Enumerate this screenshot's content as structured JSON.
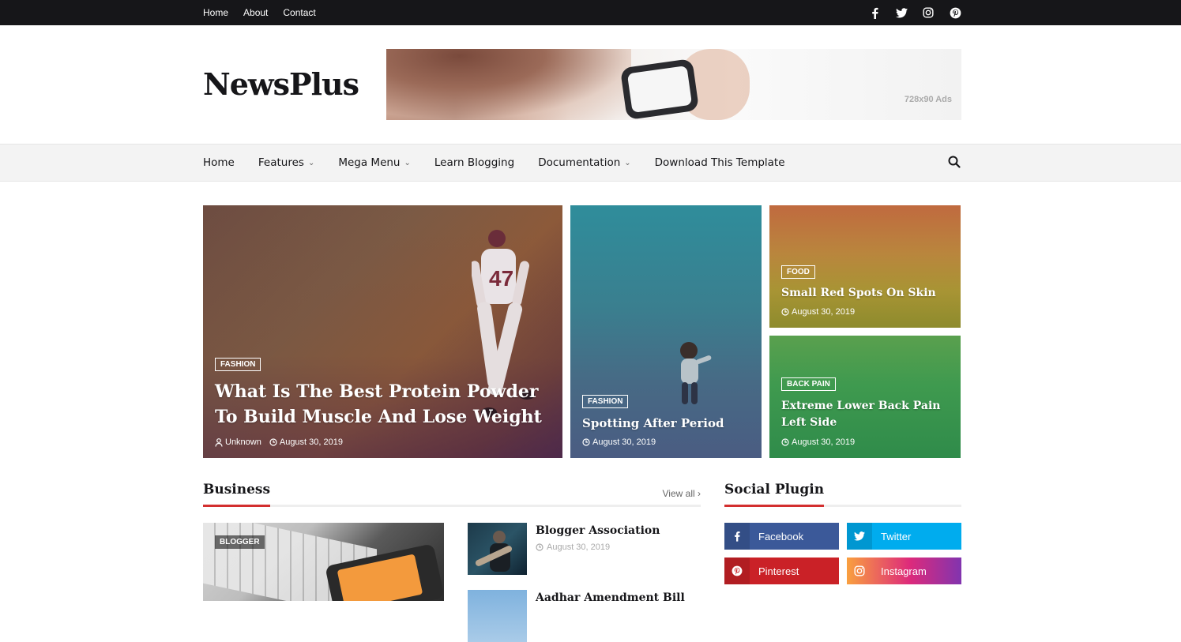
{
  "topbar": {
    "links": [
      "Home",
      "About",
      "Contact"
    ],
    "social_icons": [
      "facebook-icon",
      "twitter-icon",
      "instagram-icon",
      "pinterest-icon"
    ]
  },
  "header": {
    "logo": "NewsPlus",
    "ad_label": "728x90 Ads"
  },
  "nav": {
    "items": [
      {
        "label": "Home",
        "dropdown": false
      },
      {
        "label": "Features",
        "dropdown": true
      },
      {
        "label": "Mega Menu",
        "dropdown": true
      },
      {
        "label": "Learn Blogging",
        "dropdown": false
      },
      {
        "label": "Documentation",
        "dropdown": true
      },
      {
        "label": "Download This Template",
        "dropdown": false
      }
    ],
    "search_icon": "search-icon"
  },
  "featured": [
    {
      "label": "FASHION",
      "title": "What Is The Best Protein Powder To Build Muscle And Lose Weight",
      "author": "Unknown",
      "date": "August 30, 2019"
    },
    {
      "label": "FASHION",
      "title": "Spotting After Period",
      "date": "August 30, 2019"
    },
    {
      "label": "FOOD",
      "title": "Small Red Spots On Skin",
      "date": "August 30, 2019"
    },
    {
      "label": "BACK PAIN",
      "title": "Extreme Lower Back Pain Left Side",
      "date": "August 30, 2019"
    }
  ],
  "business": {
    "title": "Business",
    "view_all": "View all",
    "big_label": "BLOGGER",
    "posts": [
      {
        "title": "Blogger Association",
        "date": "August 30, 2019"
      },
      {
        "title": "Aadhar Amendment Bill",
        "date": ""
      }
    ]
  },
  "social_plugin": {
    "title": "Social Plugin",
    "buttons": [
      {
        "label": "Facebook",
        "color": "#3b5999"
      },
      {
        "label": "Twitter",
        "color": "#00acee"
      },
      {
        "label": "Pinterest",
        "color": "#ca2127"
      },
      {
        "label": "Instagram",
        "color": "#dd2a7b"
      }
    ]
  },
  "colors": {
    "topbar_bg": "#161619",
    "accent": "#d32f2f",
    "nav_bg": "#f3f3f3"
  }
}
